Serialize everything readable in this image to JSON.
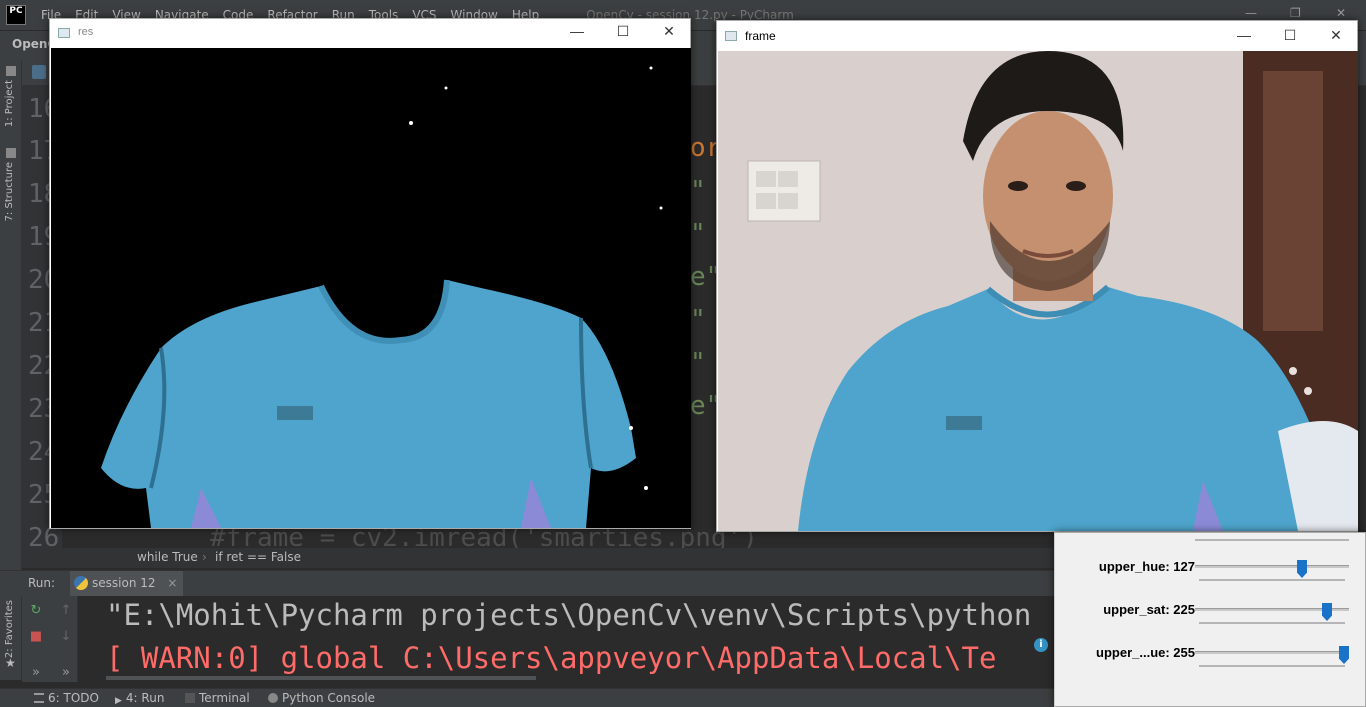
{
  "ide": {
    "logo": "PC",
    "menu": [
      "File",
      "Edit",
      "View",
      "Navigate",
      "Code",
      "Refactor",
      "Run",
      "Tools",
      "VCS",
      "Window",
      "Help"
    ],
    "title": "OpenCv - session 12.py - PyCharm",
    "project_name": "OpenC",
    "left_tool_windows": [
      "1: Project",
      "7: Structure",
      "2: Favorites"
    ],
    "line_numbers": [
      "16",
      "17",
      "18",
      "19",
      "20",
      "21",
      "22",
      "23",
      "24",
      "25",
      "26"
    ],
    "code_fragments": [
      "or",
      "\"",
      "\"",
      "e\"",
      "\"",
      "\"",
      "e\""
    ],
    "code_line_20": "#frame = cv2.imread('smarties.png')",
    "code_line_26": "#frame = cv2.imread('smarties.png')",
    "breadcrumbs": [
      "while True",
      "if ret == False"
    ],
    "run": {
      "label": "Run:",
      "tab": "session 12",
      "close": "×",
      "console_lines": [
        "\"E:\\Mohit\\Pycharm projects\\OpenCv\\venv\\Scripts\\python",
        "[ WARN:0] global C:\\Users\\appveyor\\AppData\\Local\\Te"
      ]
    },
    "statusbar": [
      "6: TODO",
      "4: Run",
      "Terminal",
      "Python Console"
    ],
    "colors": {
      "console_text": "#bbbbbb",
      "warn_text": "#ff6b68",
      "ide_bg": "#2b2b2b",
      "panel_bg": "#3c3f41"
    }
  },
  "windows": {
    "res": {
      "title": "res"
    },
    "frame": {
      "title": "frame"
    }
  },
  "trackbars": [
    {
      "label": "upper_hue: 127",
      "value": 127,
      "max": 179
    },
    {
      "label": "upper_sat: 225",
      "value": 225,
      "max": 255
    },
    {
      "label": "upper_...ue: 255",
      "value": 255,
      "max": 255
    }
  ]
}
